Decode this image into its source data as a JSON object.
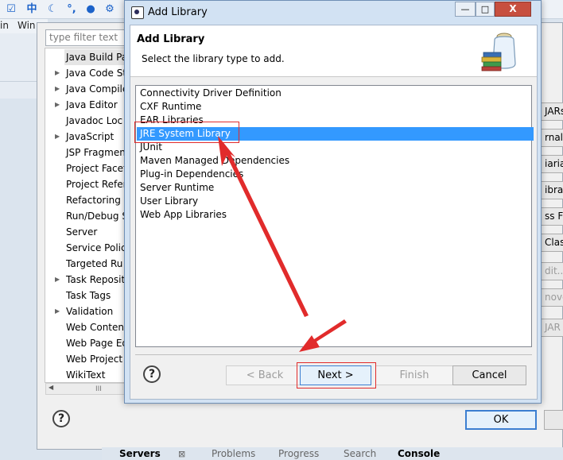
{
  "toolbar": {
    "icons": [
      "toolbar-icon-1",
      "input-method-icon",
      "moon-icon",
      "punctuation-icon",
      "user-icon",
      "settings-icon"
    ],
    "glyphs": [
      "☑",
      "中",
      "☾",
      "°,",
      "●",
      "⚙"
    ]
  },
  "menu": {
    "item1": "in",
    "item2": "Win"
  },
  "preferences": {
    "filter_placeholder": "type filter text",
    "tree_items": [
      {
        "label": "Java Build Pa",
        "arrow": ""
      },
      {
        "label": "Java Code St",
        "arrow": "▶"
      },
      {
        "label": "Java Compile",
        "arrow": "▶"
      },
      {
        "label": "Java Editor",
        "arrow": "▶"
      },
      {
        "label": "Javadoc Loc",
        "arrow": ""
      },
      {
        "label": "JavaScript",
        "arrow": "▶"
      },
      {
        "label": "JSP Fragmen",
        "arrow": ""
      },
      {
        "label": "Project Facet",
        "arrow": ""
      },
      {
        "label": "Project Refer",
        "arrow": ""
      },
      {
        "label": "Refactoring",
        "arrow": ""
      },
      {
        "label": "Run/Debug S",
        "arrow": ""
      },
      {
        "label": "Server",
        "arrow": ""
      },
      {
        "label": "Service Polic",
        "arrow": ""
      },
      {
        "label": "Targeted Ru",
        "arrow": ""
      },
      {
        "label": "Task Reposit",
        "arrow": "▶"
      },
      {
        "label": "Task Tags",
        "arrow": ""
      },
      {
        "label": "Validation",
        "arrow": "▶"
      },
      {
        "label": "Web Content",
        "arrow": ""
      },
      {
        "label": "Web Page Ed",
        "arrow": ""
      },
      {
        "label": "Web Project",
        "arrow": ""
      },
      {
        "label": "WikiText",
        "arrow": ""
      }
    ],
    "right_buttons": [
      "JARs",
      "rnal",
      "iariab",
      "ibrar",
      "ss Fo",
      "Clas",
      "dit...",
      "nove",
      "JAR"
    ],
    "ok_label": "OK",
    "scroll_thumb": "III"
  },
  "bottom_tabs": {
    "servers": "Servers",
    "problems": "Problems",
    "progress": "Progress",
    "search": "Search",
    "console": "Console"
  },
  "dialog": {
    "title": "Add Library",
    "heading": "Add Library",
    "subheading": "Select the library type to add.",
    "libraries": [
      "Connectivity Driver Definition",
      "CXF Runtime",
      "EAR Libraries",
      "JRE System Library",
      "JUnit",
      "Maven Managed Dependencies",
      "Plug-in Dependencies",
      "Server Runtime",
      "User Library",
      "Web App Libraries"
    ],
    "selected_library": "JRE System Library",
    "buttons": {
      "back": "< Back",
      "next": "Next >",
      "finish": "Finish",
      "cancel": "Cancel"
    },
    "help": "?",
    "window_controls": {
      "minimize": "—",
      "maximize": "□",
      "close": "X"
    }
  },
  "colors": {
    "selection": "#3399ff",
    "annotation": "#e12b2b",
    "dialog_frame": "#d2e2f3"
  }
}
